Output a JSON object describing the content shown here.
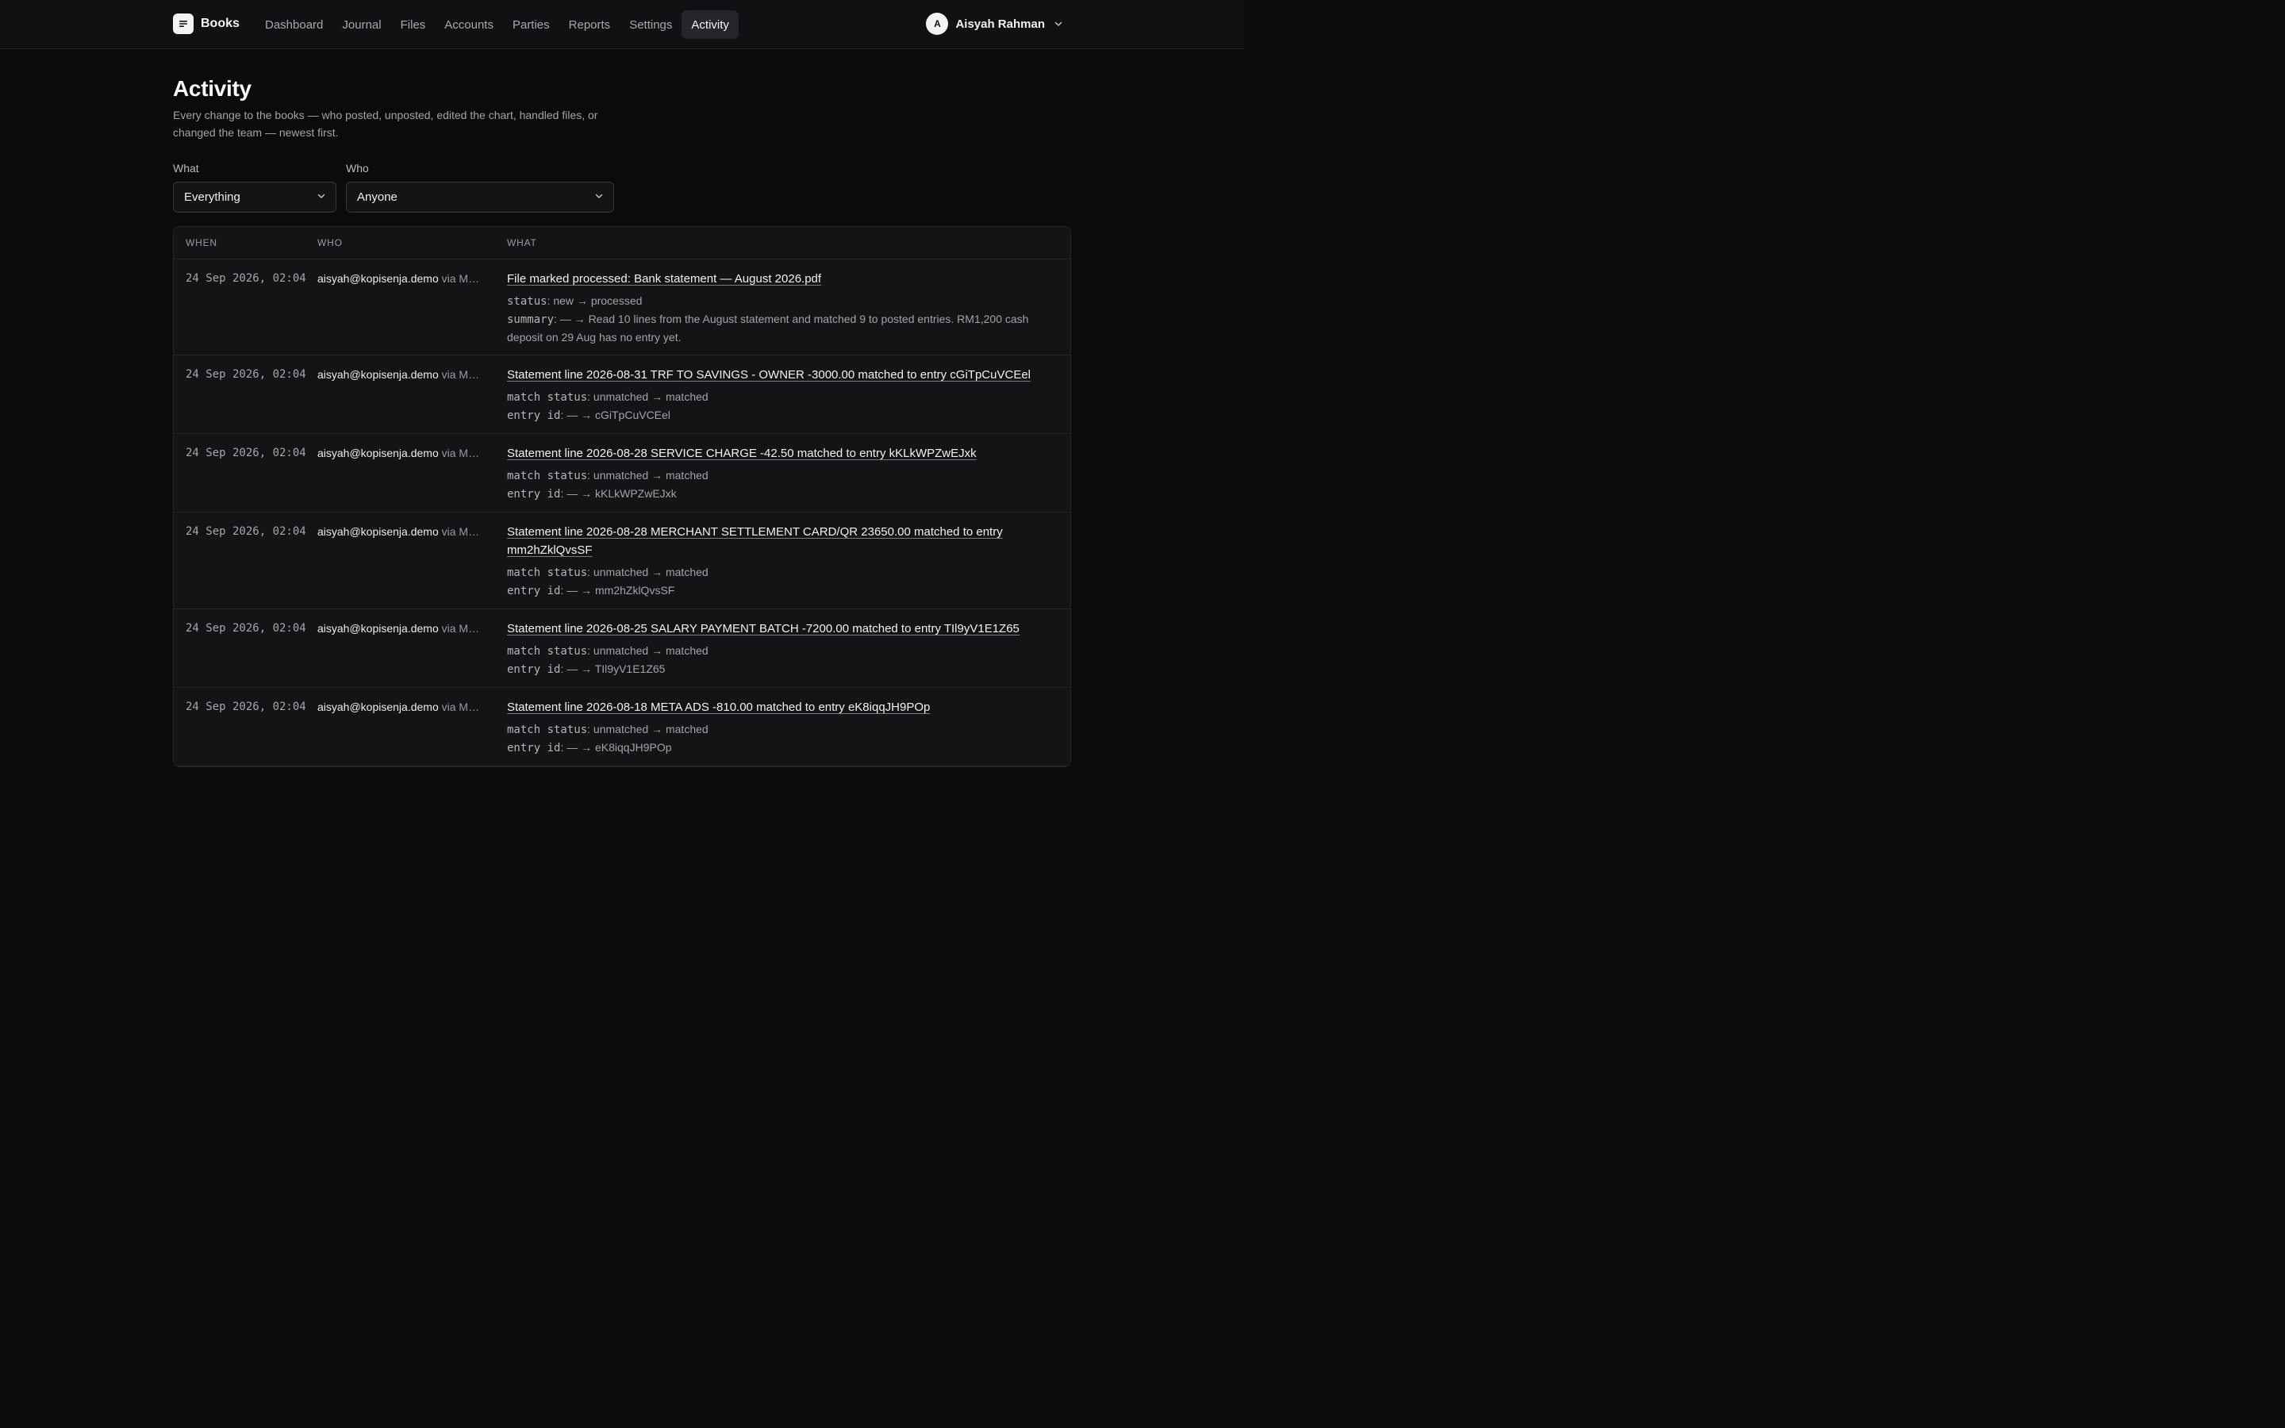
{
  "app": {
    "name": "Books",
    "brand_icon": "document-lines-icon"
  },
  "nav": {
    "items": [
      {
        "label": "Dashboard"
      },
      {
        "label": "Journal"
      },
      {
        "label": "Files"
      },
      {
        "label": "Accounts"
      },
      {
        "label": "Parties"
      },
      {
        "label": "Reports"
      },
      {
        "label": "Settings"
      },
      {
        "label": "Activity",
        "active": true
      }
    ]
  },
  "user": {
    "initial": "A",
    "name": "Aisyah Rahman"
  },
  "page": {
    "title": "Activity",
    "subtitle": "Every change to the books — who posted, unposted, edited the chart, handled files, or changed the team — newest first."
  },
  "filters": {
    "what": {
      "label": "What",
      "value": "Everything"
    },
    "who": {
      "label": "Who",
      "value": "Anyone"
    }
  },
  "table": {
    "headers": {
      "when": "WHEN",
      "who": "WHO",
      "what": "WHAT"
    },
    "rows": [
      {
        "when": "24 Sep 2026, 02:04",
        "who": "aisyah@kopisenja.demo",
        "via": "via M…",
        "title": "File marked processed: Bank statement — August 2026.pdf",
        "changes": [
          {
            "key": "status",
            "value": ": new → processed"
          },
          {
            "key": "summary",
            "value": ": — → Read 10 lines from the August statement and matched 9 to posted entries. RM1,200 cash deposit on 29 Aug has no entry yet."
          }
        ]
      },
      {
        "when": "24 Sep 2026, 02:04",
        "who": "aisyah@kopisenja.demo",
        "via": "via M…",
        "title": "Statement line 2026-08-31 TRF TO SAVINGS - OWNER -3000.00 matched to entry cGiTpCuVCEel",
        "changes": [
          {
            "key": "match status",
            "value": ": unmatched → matched"
          },
          {
            "key": "entry id",
            "value": ": — → cGiTpCuVCEel"
          }
        ]
      },
      {
        "when": "24 Sep 2026, 02:04",
        "who": "aisyah@kopisenja.demo",
        "via": "via M…",
        "title": "Statement line 2026-08-28 SERVICE CHARGE -42.50 matched to entry kKLkWPZwEJxk",
        "changes": [
          {
            "key": "match status",
            "value": ": unmatched → matched"
          },
          {
            "key": "entry id",
            "value": ": — → kKLkWPZwEJxk"
          }
        ]
      },
      {
        "when": "24 Sep 2026, 02:04",
        "who": "aisyah@kopisenja.demo",
        "via": "via M…",
        "title": "Statement line 2026-08-28 MERCHANT SETTLEMENT CARD/QR 23650.00 matched to entry mm2hZklQvsSF",
        "changes": [
          {
            "key": "match status",
            "value": ": unmatched → matched"
          },
          {
            "key": "entry id",
            "value": ": — → mm2hZklQvsSF"
          }
        ]
      },
      {
        "when": "24 Sep 2026, 02:04",
        "who": "aisyah@kopisenja.demo",
        "via": "via M…",
        "title": "Statement line 2026-08-25 SALARY PAYMENT BATCH -7200.00 matched to entry TIl9yV1E1Z65",
        "changes": [
          {
            "key": "match status",
            "value": ": unmatched → matched"
          },
          {
            "key": "entry id",
            "value": ": — → TIl9yV1E1Z65"
          }
        ]
      },
      {
        "when": "24 Sep 2026, 02:04",
        "who": "aisyah@kopisenja.demo",
        "via": "via M…",
        "title": "Statement line 2026-08-18 META ADS -810.00 matched to entry eK8iqqJH9POp",
        "changes": [
          {
            "key": "match status",
            "value": ": unmatched → matched"
          },
          {
            "key": "entry id",
            "value": ": — → eK8iqqJH9POp"
          }
        ]
      }
    ]
  }
}
